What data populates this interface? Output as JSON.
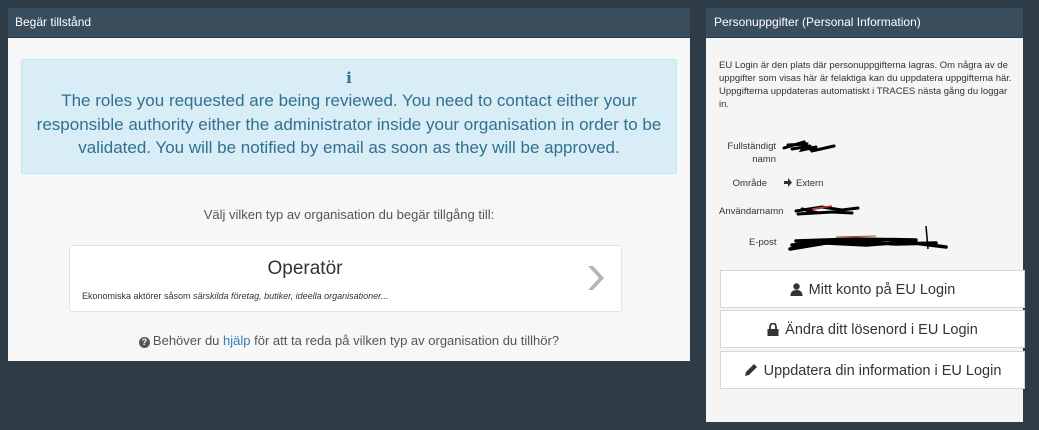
{
  "left": {
    "header": "Begär tillstånd",
    "alert": {
      "icon": "info-icon",
      "message": "The roles you requested are being reviewed. You need to contact either your responsible authority either the administrator inside your organisation in order to be validated. You will be notified by email as soon as they will be approved."
    },
    "org_prompt": "Välj vilken typ av organisation du begär tillgång till:",
    "org_card": {
      "title": "Operatör",
      "desc_plain": "Ekonomiska aktörer såsom ",
      "desc_italic": "särskilda företag, butiker, ideella organisationer...",
      "icon": "chevron-right-icon"
    },
    "help": {
      "icon": "question-circle-icon",
      "before": "Behöver du ",
      "link": "hjälp",
      "after": " för att ta reda på vilken typ av organisation du tillhör?"
    }
  },
  "right": {
    "header": "Personuppgifter (Personal Information)",
    "intro": "EU Login är den plats där personuppgifterna lagras. Om några av de uppgifter som visas här är felaktiga kan du uppdatera uppgifterna här. Uppgifterna uppdateras automatiskt i TRACES nästa gång du loggar in.",
    "fields": {
      "fullname_label_1": "Fullständigt",
      "fullname_label_2": "namn",
      "area_label": "Område",
      "area_value": "Extern",
      "area_icon": "sign-in-icon",
      "username_label": "Användarnamn",
      "email_label": "E-post"
    },
    "buttons": {
      "account": "Mitt konto på EU Login",
      "password": "Ändra ditt lösenord i EU Login",
      "update": "Uppdatera din information i EU Login"
    }
  },
  "colors": {
    "header_bg": "#3a4d5c",
    "alert_bg": "#d9edf7",
    "alert_text": "#31708f",
    "link": "#337ab7",
    "page_bg": "#2e3c48"
  }
}
